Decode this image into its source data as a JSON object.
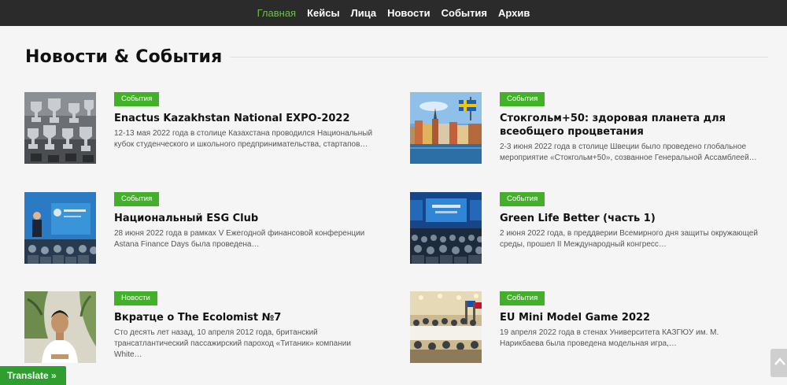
{
  "nav": {
    "items": [
      "Главная",
      "Кейсы",
      "Лица",
      "Новости",
      "События",
      "Архив"
    ],
    "active_color": "#6cc04a"
  },
  "section": {
    "title": "Новости & События"
  },
  "posts": [
    {
      "category": "События",
      "title": "Enactus Kazakhstan National EXPO-2022",
      "excerpt": "12-13 мая 2022 года в столице Казахстана проводился Национальный кубок студенческого и школьного предпринимательства, стартапов…",
      "image": "trophies-image"
    },
    {
      "category": "События",
      "title": "Стокгольм+50: здоровая планета для всеобщего процветания",
      "excerpt": "2-3 июня 2022 года в столице Швеции было проведено глобальное мероприятие «Стокгольм+50», созванное Генеральной Ассамблеей…",
      "image": "stockholm-image"
    },
    {
      "category": "События",
      "title": "Национальный ESG Club",
      "excerpt": "28 июня 2022 года в рамках V Ежегодной финансовой конференции Astana Finance Days была проведена…",
      "image": "conference-stage-image"
    },
    {
      "category": "События",
      "title": "Green Life Better (часть 1)",
      "excerpt": "2 июня 2022 года, в преддверии Всемирного дня защиты окружающей среды, прошел II Международный конгресс…",
      "image": "congress-hall-image"
    },
    {
      "category": "Новости",
      "title": "Вкратце о The Ecolomist №7",
      "excerpt": "Сто десять лет назад, 10 апреля 2012 года, британский трансатлантический пассажирский пароход «Титаник» компании White…",
      "image": "man-portrait-image"
    },
    {
      "category": "События",
      "title": "EU Mini Model Game 2022",
      "excerpt": "19 апреля 2022 года в стенах Университета КАЗГЮУ им. М. Нарикбаева была проведена модельная игра,…",
      "image": "meeting-room-image"
    }
  ],
  "translate": {
    "label": "Translate »"
  },
  "colors": {
    "badge": "#43b02a",
    "nav_bg": "#2b2b2b",
    "page_bg": "#f5f5f5"
  }
}
